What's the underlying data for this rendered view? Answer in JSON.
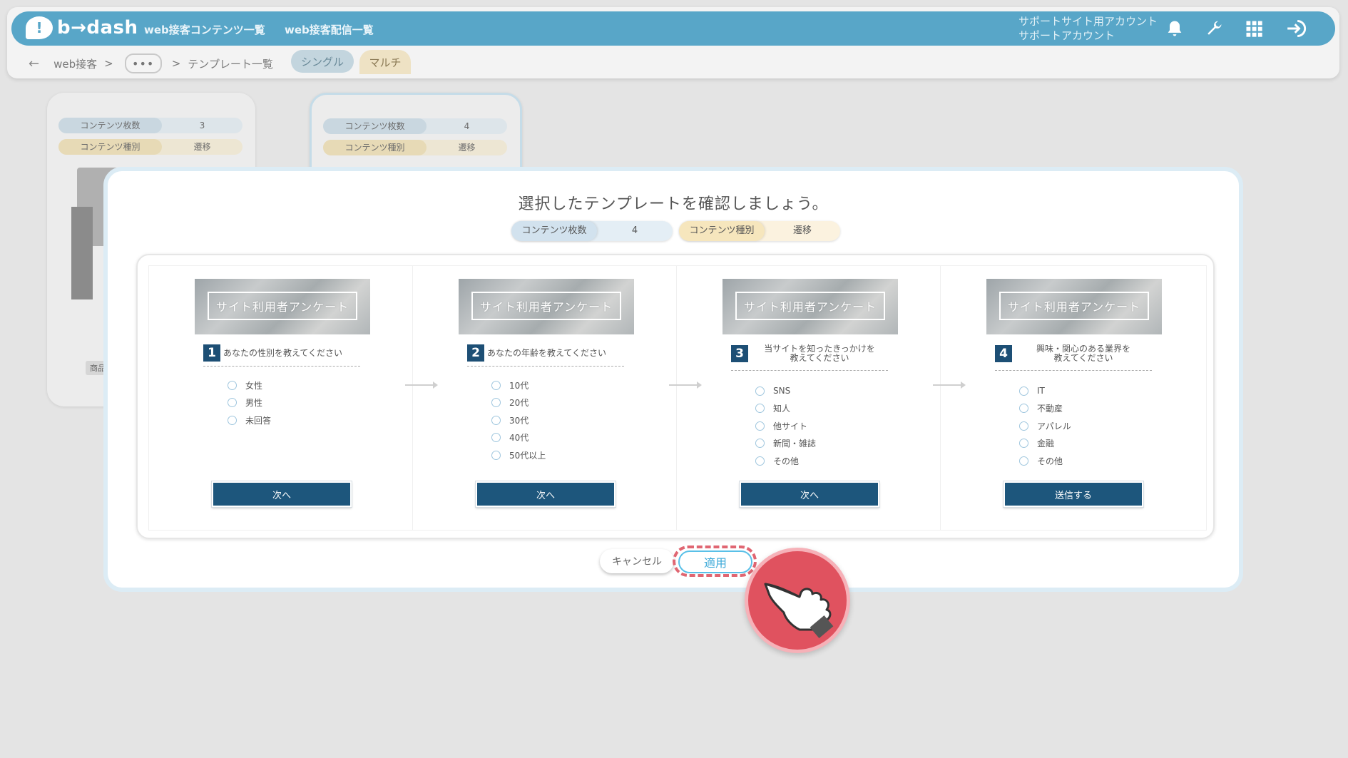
{
  "header": {
    "logo_text": "b→dash",
    "nav": [
      "web接客コンテンツ一覧",
      "web接客配信一覧"
    ],
    "account_line1": "サポートサイト用アカウント",
    "account_line2": "サポートアカウント",
    "icons": [
      "bell-icon",
      "wrench-icon",
      "grid-icon",
      "logout-icon"
    ]
  },
  "breadcrumb": {
    "back": "←",
    "item1": "web接客",
    "sep": ">",
    "ellipsis": "•••",
    "item2": "テンプレート一覧"
  },
  "tabs": {
    "single": "シングル",
    "multi": "マルチ"
  },
  "bg_cards": [
    {
      "count_label": "コンテンツ枚数",
      "count": "3",
      "type_label": "コンテンツ種別",
      "type": "遷移",
      "tag": "商品"
    },
    {
      "count_label": "コンテンツ枚数",
      "count": "4",
      "type_label": "コンテンツ種別",
      "type": "遷移"
    }
  ],
  "modal": {
    "title": "選択したテンプレートを確認しましょう。",
    "count_label": "コンテンツ枚数",
    "count": "4",
    "type_label": "コンテンツ種別",
    "type": "遷移",
    "pages": [
      {
        "banner": "サイト利用者アンケート",
        "num": "1",
        "question": "あなたの性別を教えてください",
        "options": [
          "女性",
          "男性",
          "未回答"
        ],
        "button": "次へ"
      },
      {
        "banner": "サイト利用者アンケート",
        "num": "2",
        "question": "あなたの年齢を教えてください",
        "options": [
          "10代",
          "20代",
          "30代",
          "40代",
          "50代以上"
        ],
        "button": "次へ"
      },
      {
        "banner": "サイト利用者アンケート",
        "num": "3",
        "question_l1": "当サイトを知ったきっかけを",
        "question_l2": "教えてください",
        "options": [
          "SNS",
          "知人",
          "他サイト",
          "新聞・雑誌",
          "その他"
        ],
        "button": "次へ"
      },
      {
        "banner": "サイト利用者アンケート",
        "num": "4",
        "question_l1": "興味・関心のある業界を",
        "question_l2": "教えてください",
        "options": [
          "IT",
          "不動産",
          "アパレル",
          "金融",
          "その他"
        ],
        "button": "送信する"
      }
    ],
    "cancel": "キャンセル",
    "apply": "適用"
  },
  "colors": {
    "header": "#58a6c8",
    "primary_button": "#1d567c",
    "highlight": "#e0525f",
    "apply_text": "#3aa8d8"
  }
}
